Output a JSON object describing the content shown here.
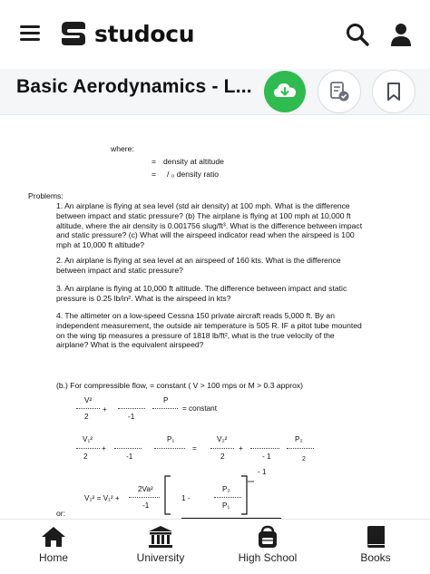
{
  "app": {
    "brand": "studocu"
  },
  "header": {
    "doc_title": "Basic Aerodynamics - L..."
  },
  "document": {
    "where_label": "where:",
    "def1_sym": "=",
    "def1_text": "density at altitude",
    "def2_sym": "=",
    "def2_text": "/  ₀ density ratio",
    "problems_label": "Problems:",
    "problem1": "1.  An airplane is flying at sea level (std air density) at 100 mph.  What is the difference between impact and static pressure?  (b)  The airplane is flying at 100 mph at 10,000 ft altitude, where the air density is 0.001756 slug/ft³.  What is the difference between impact and static pressure?  (c)  What will the airspeed indicator read when the airspeed is 100 mph at 10,000 ft altitude?",
    "problem2": "2.  An airplane is flying at sea level at an airspeed of 160 kts.  What is the difference between impact and static pressure?",
    "problem3": "3.  An airplane is flying at 10,000 ft altitude.  The difference between impact and static pressure is 0.25 lb/in².  What is the airspeed in kts?",
    "problem4": "4.  The altimeter on a low-speed Cessna 150 private aircraft reads 5,000 ft.  By an independent measurement, the outside air temperature is 505 R.  IF a pitot tube mounted on the wing tip measures a pressure of 1818 lb/ft², what is the true velocity of the airplane?  What is the equivalent airspeed?",
    "compressible_line": "(b.)  For compressible flow,      = constant ( V > 100 mps or M > 0.3 approx)",
    "eq1_v2": "V²",
    "eq1_2": "2",
    "eq1_plus": "+",
    "eq1_m1": "-1",
    "eq1_p": "P",
    "eq1_const": "= constant",
    "eq2_v1": "V₁²",
    "eq2_2a": "2",
    "eq2_plus1": "+",
    "eq2_m1a": "-1",
    "eq2_p1": "P₁",
    "eq2_eq": "=",
    "eq2_v2": "V₂²",
    "eq2_2b": "2",
    "eq2_plus2": "+",
    "eq2_m1b": "- 1",
    "eq2_p2": "P₂",
    "eq2_sub2": "2",
    "eq3_m1top": "- 1",
    "eq3_lhs": "V₂²  =  V₁²  +",
    "eq3_num": "2Va²",
    "eq3_den": "-1",
    "eq3_one": "1 -",
    "eq3_p2": "P₂",
    "eq3_p1": "P₁",
    "or_label": "or:"
  },
  "bottom_nav": {
    "home": "Home",
    "university": "University",
    "high_school": "High School",
    "books": "Books"
  },
  "colors": {
    "accent_green": "#2fbb4f",
    "text": "#111111",
    "icon": "#1c1c1c"
  },
  "icons": [
    "menu-icon",
    "studocu-logo",
    "search-icon",
    "user-icon",
    "download-icon",
    "quiz-icon",
    "bookmark-icon",
    "home-icon",
    "university-icon",
    "high-school-icon",
    "books-icon"
  ]
}
